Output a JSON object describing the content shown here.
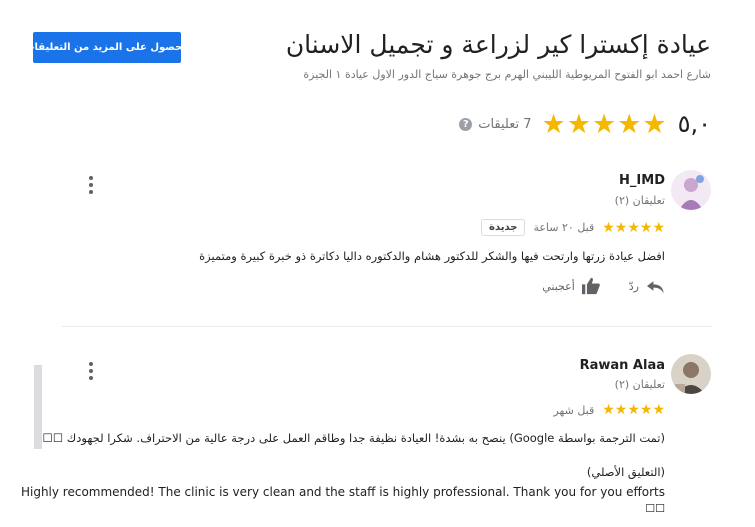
{
  "header": {
    "more_reviews_button": "الحصول على المزيد من التعليقات",
    "title": "عيادة إكسترا كير لزراعة و تجميل الاسنان",
    "address": "شارع احمد ابو الفتوح المريوطية الليبني الهرم برج جوهرة سياج الدور الاول عيادة ١ الجيزة",
    "rating_value": "٥,٠",
    "rating_stars": 5,
    "review_count": "7 تعليقات"
  },
  "colors": {
    "accent": "#1a73e8",
    "star": "#f5b700"
  },
  "reviews": [
    {
      "name": "H_IMD",
      "meta": "تعليقان (٢)",
      "stars": 5,
      "time": "قبل ٢٠ ساعة",
      "badge": "جديدة",
      "text": "افضل عيادة زرتها وارتحت فيها والشكر للدكتور هشام  والدكتوره داليا دكاترة ذو خبرة كبيرة ومتميزة",
      "reply_label": "ردّ",
      "like_label": "أعجبني"
    },
    {
      "name": "Rawan Alaa",
      "meta": "تعليقان (٢)",
      "stars": 5,
      "time": "قبل شهر",
      "translated_text": "(تمت الترجمة بواسطة Google) ينصح به بشدة! العيادة نظيفة جدا وطاقم العمل على درجة عالية من الاحتراف. شكرا لجهودك ☐☐",
      "original_label": "(التعليق الأصلي)",
      "original_text_1": "Highly recommended! The clinic is very clean and the staff is highly professional. Thank you for you efforts",
      "original_text_2": "☐☐"
    }
  ]
}
